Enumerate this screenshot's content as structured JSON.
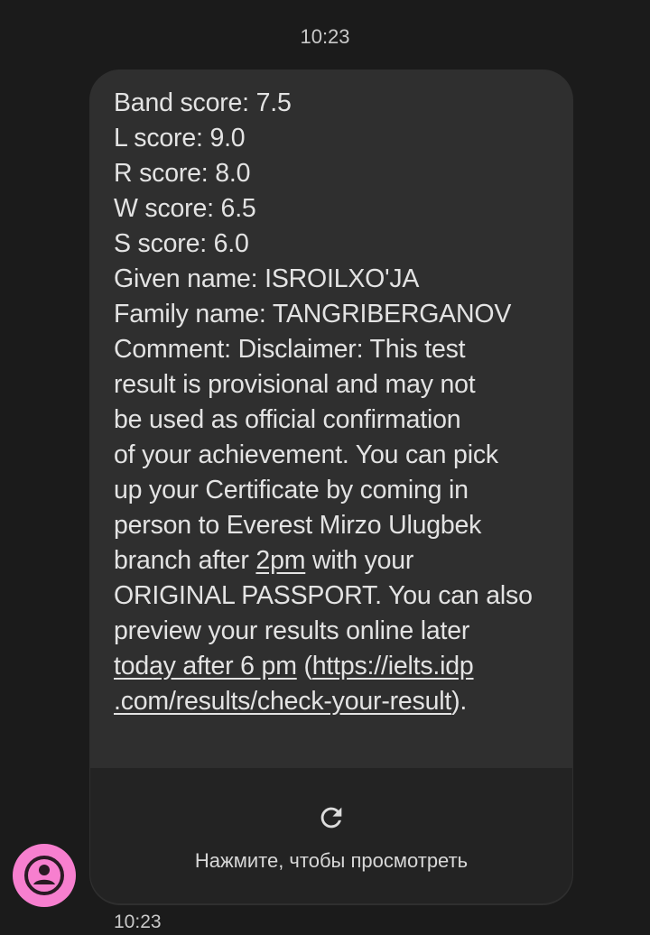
{
  "timestamps": {
    "top": "10:23",
    "bottom": "10:23"
  },
  "message": {
    "lines": [
      "Band score: 7.5",
      "L score: 9.0",
      "R score: 8.0",
      "W score: 6.5",
      "S score: 6.0",
      "Given name: ISROILXO'JA",
      "Family name: TANGRIBERGANOV",
      "Comment: Disclaimer: This test",
      "result is provisional and may not",
      "be used as official confirmation",
      "of your achievement. You can pick",
      "up your Certificate by coming in",
      "person to Everest Mirzo Ulugbek"
    ],
    "branch_prefix": "branch after ",
    "time_link": "2pm",
    "branch_suffix": " with your",
    "line_passport": "ORIGINAL PASSPORT. You can also",
    "line_preview": "preview your results online later",
    "today_link": "today after 6 pm",
    "open_paren": " (",
    "url_part1": "https://ielts.idp",
    "url_part2": ".com/results/check-your-result",
    "close_paren": ")."
  },
  "attachment": {
    "label": "Нажмите, чтобы просмотреть",
    "icon": "reload-icon"
  },
  "avatar": {
    "icon": "person-icon",
    "color": "#f77fcf"
  }
}
